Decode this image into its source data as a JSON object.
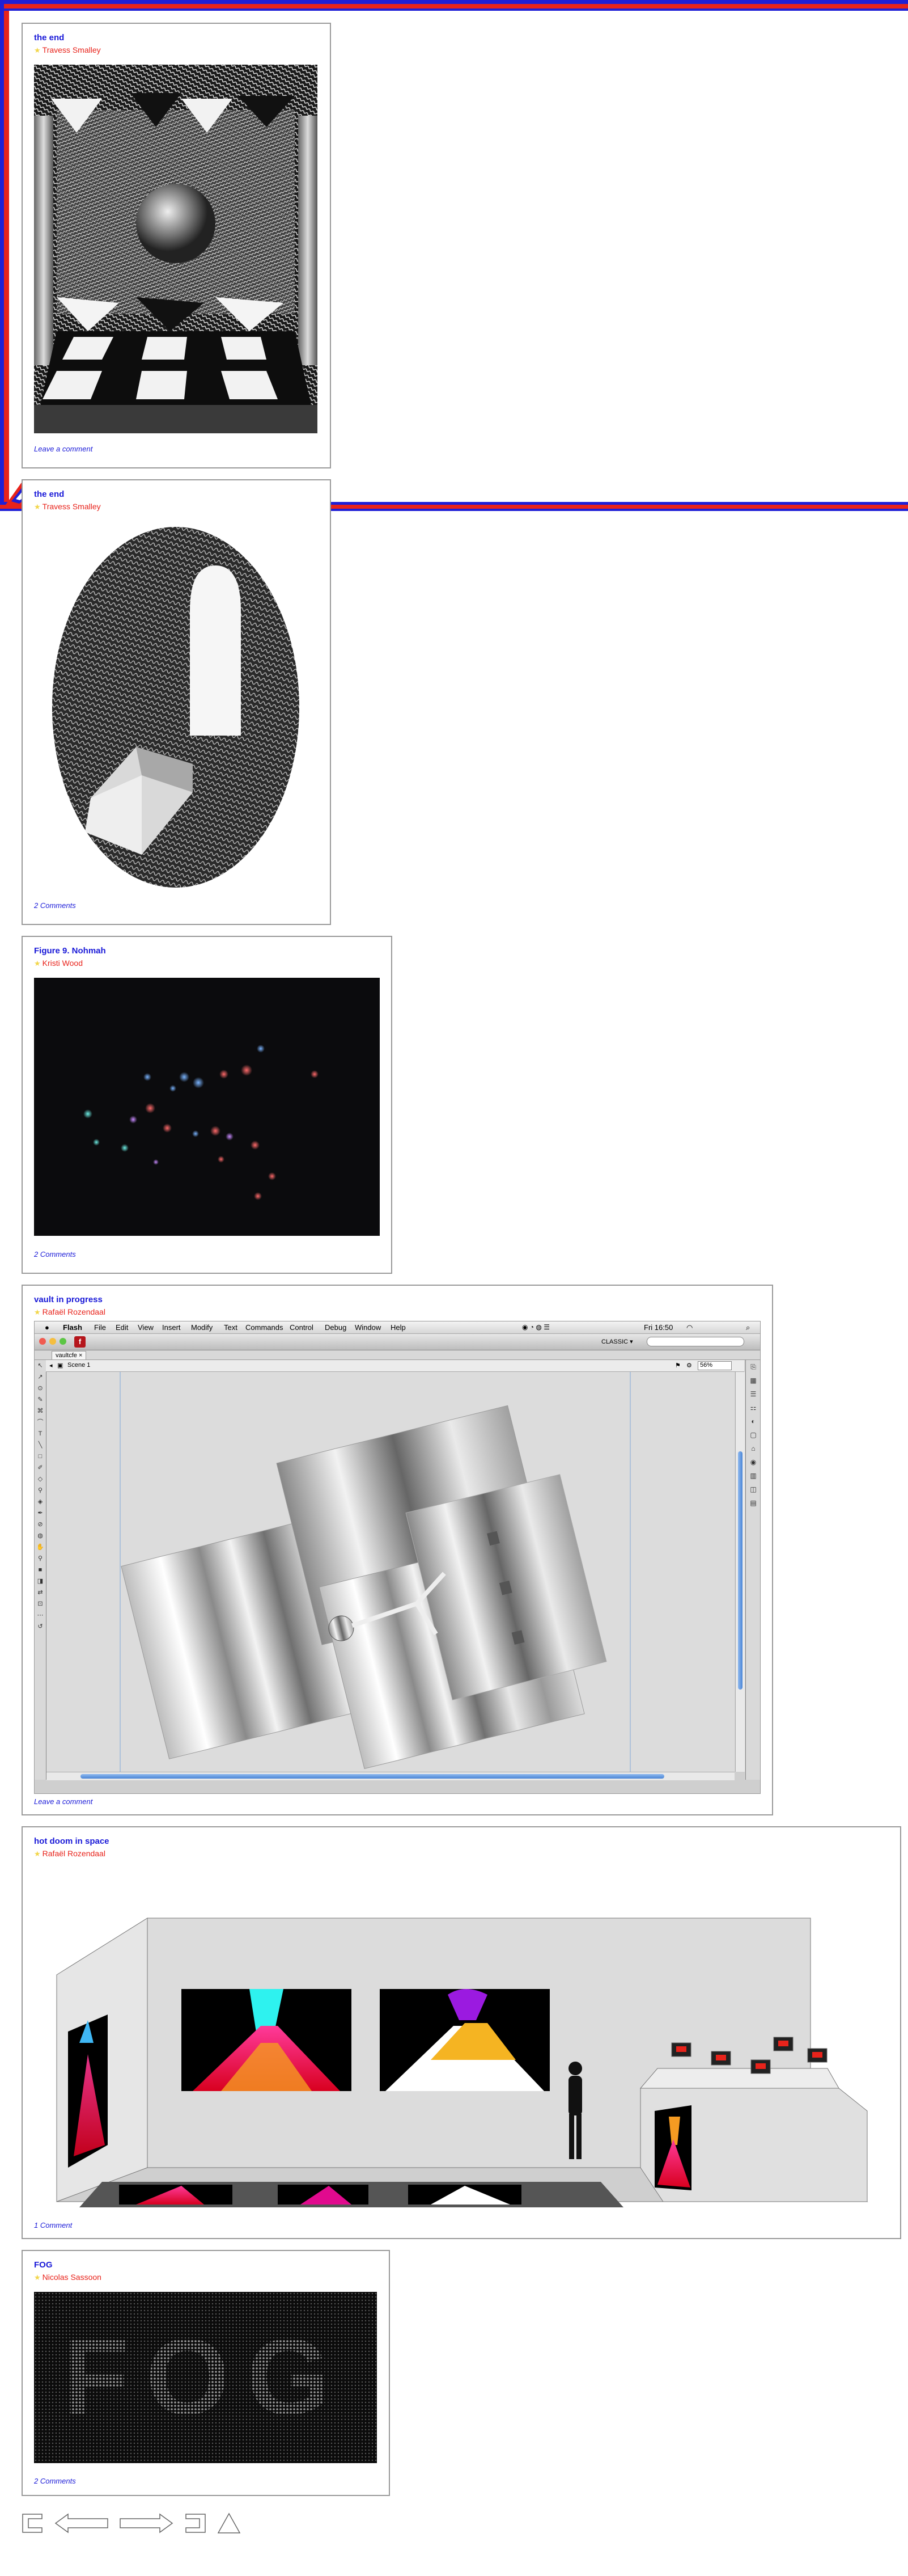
{
  "colors": {
    "title_blue": "#1a1ad8",
    "author_red": "#e8231b",
    "star_yellow": "#f2d64a",
    "border_gray": "#9a9a9a"
  },
  "posts": [
    {
      "title": "the end",
      "author": "Travess Smalley",
      "comments": "Leave a comment"
    },
    {
      "title": "the end",
      "author": "Travess Smalley",
      "comments": "2 Comments"
    },
    {
      "title": "Figure 9. Nohmah",
      "author": "Kristi Wood",
      "comments": "2 Comments"
    },
    {
      "title": "vault in progress",
      "author": "Rafaël Rozendaal",
      "comments": "Leave a comment"
    },
    {
      "title": "hot doom in space",
      "author": "Rafaël Rozendaal",
      "comments": "1 Comment"
    },
    {
      "title": "FOG",
      "author": "Nicolas Sassoon",
      "comments": "2 Comments"
    }
  ],
  "author_icon": "star-icon",
  "flash_ui": {
    "menubar": [
      "Flash",
      "File",
      "Edit",
      "View",
      "Insert",
      "Modify",
      "Text",
      "Commands",
      "Control",
      "Debug",
      "Window",
      "Help"
    ],
    "clock": "Fri 16:50",
    "workspace": "CLASSIC ▾",
    "tab_label": "vaultcfe",
    "scene_label": "Scene 1",
    "zoom": "56%"
  },
  "fog_text": "FOG",
  "pagination": {
    "icons": [
      "first-page-icon",
      "previous-page-icon",
      "next-page-icon",
      "last-page-icon",
      "top-icon"
    ]
  }
}
